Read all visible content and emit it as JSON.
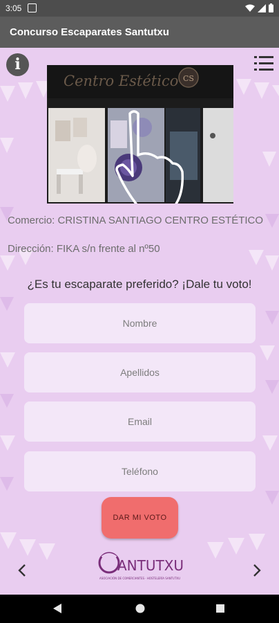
{
  "status_bar": {
    "time": "3:05"
  },
  "app_bar": {
    "title": "Concurso Escaparates Santutxu"
  },
  "shop": {
    "sign_text": "Centro Estético",
    "sign_monogram": "CS",
    "comercio": "Comercio: CRISTINA SANTIAGO CENTRO ESTÉTICO",
    "direccion": "Dirección: FIKA s/n frente al nº50"
  },
  "vote": {
    "question": "¿Es tu escaparate preferido? ¡Dale tu voto!",
    "fields": {
      "nombre_placeholder": "Nombre",
      "apellidos_placeholder": "Apellidos",
      "email_placeholder": "Email",
      "telefono_placeholder": "Teléfono"
    },
    "submit_label": "DAR MI VOTO"
  },
  "logo": {
    "name": "ANTUTXU",
    "tagline": "ASOCIACIÓN DE COMERCIANTES · HOSTELERÍA SANTUTXU"
  },
  "colors": {
    "background": "#e9cdf0",
    "app_bar": "#5c5c5c",
    "button": "#f06d6d",
    "logo": "#7a2e7a"
  },
  "icons": {
    "info": "info-icon",
    "menu": "menu-icon",
    "prev": "chevron-left-icon",
    "next": "chevron-right-icon"
  }
}
